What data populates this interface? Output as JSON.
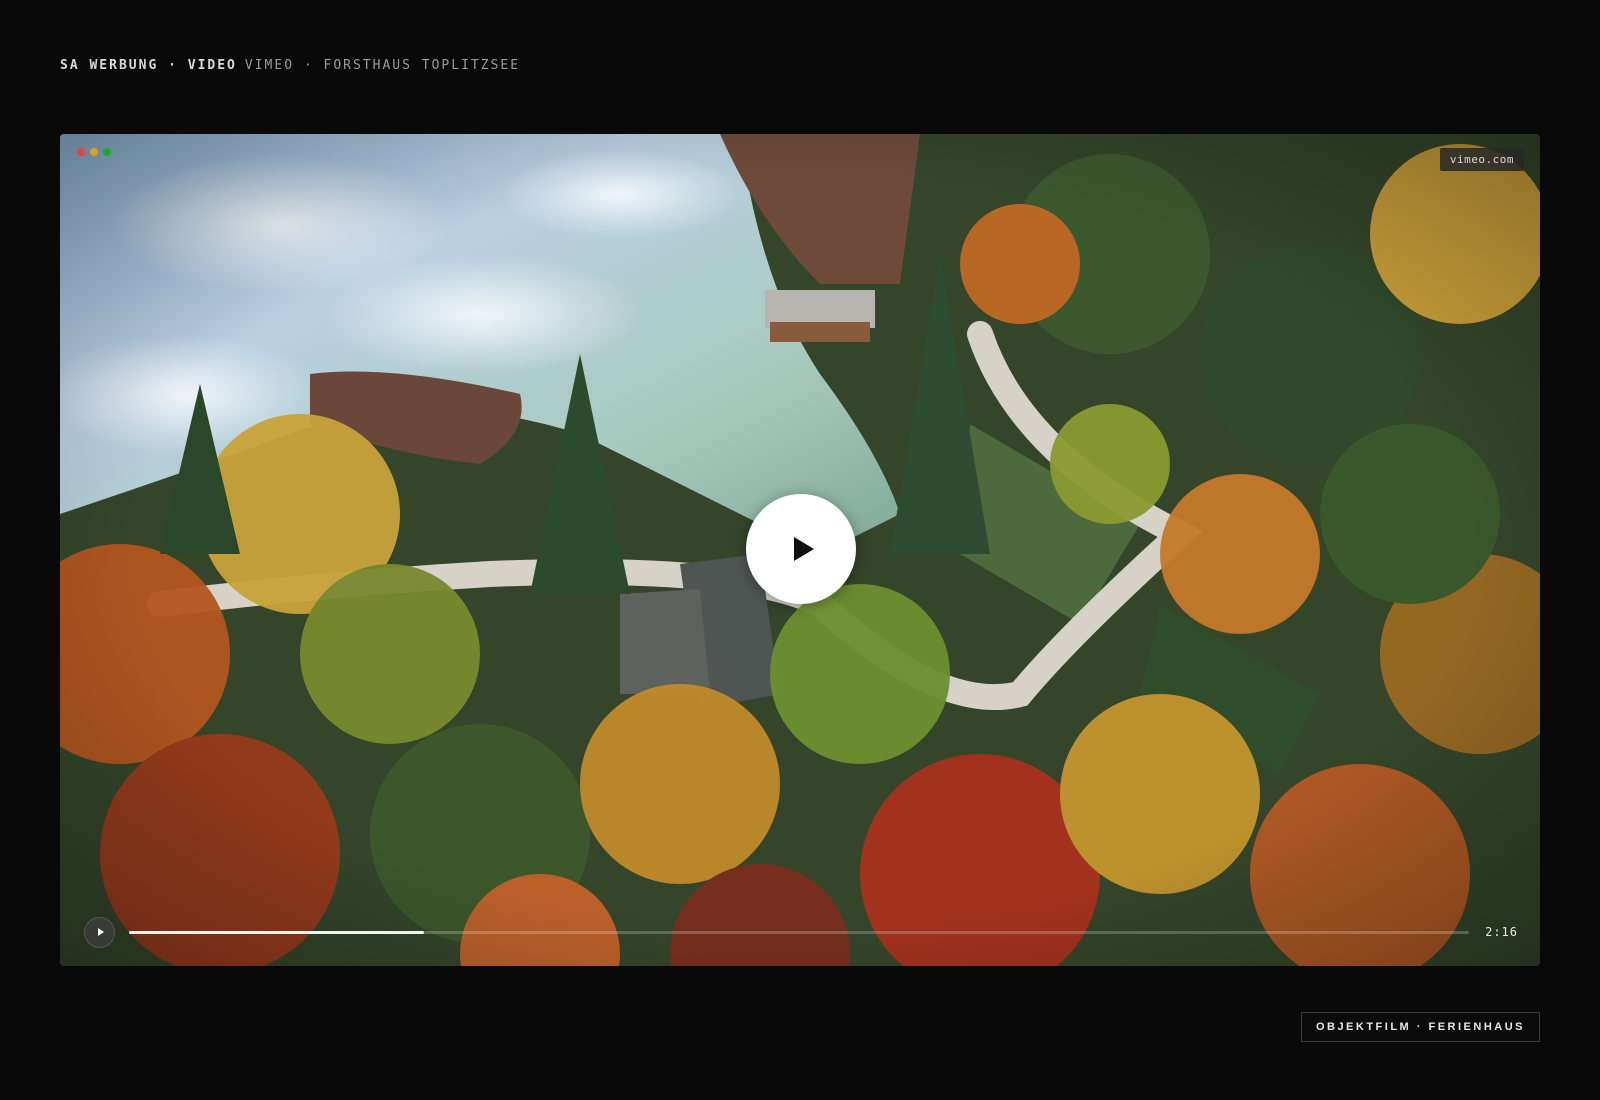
{
  "header": {
    "brand": "SA WERBUNG · VIDEO",
    "meta": "VIMEO · FORSTHAUS TOPLITZSEE"
  },
  "player": {
    "host_badge": "vimeo.com",
    "duration": "2:16",
    "progress_fraction": 0.22,
    "window_dots": [
      "#e0443e",
      "#dea123",
      "#1aab29"
    ],
    "poster_description_icon": "aerial-forest-lake-thumbnail"
  },
  "footer": {
    "tag": "OBJEKTFILM · FERIENHAUS"
  },
  "colors": {
    "background": "#0a0909",
    "accent": "#ffffff"
  }
}
